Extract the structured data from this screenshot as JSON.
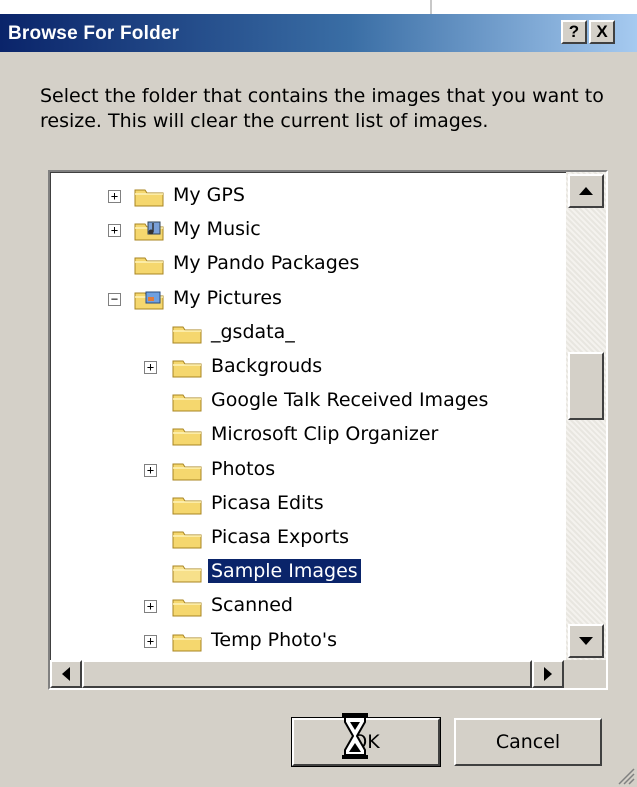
{
  "dialog": {
    "title": "Browse For Folder",
    "help_button": "?",
    "close_button": "X",
    "prompt": "Select the folder that contains the images that you want to resize.  This will clear the current list of images."
  },
  "tree": {
    "items": [
      {
        "label": "My GPS",
        "expander": "+",
        "icon": "folder-icon"
      },
      {
        "label": "My Music",
        "expander": "+",
        "icon": "music-folder-icon"
      },
      {
        "label": "My Pando Packages",
        "expander": "",
        "icon": "folder-icon"
      },
      {
        "label": "My Pictures",
        "expander": "−",
        "icon": "pictures-folder-icon"
      },
      {
        "label": "_gsdata_",
        "expander": "",
        "icon": "folder-icon"
      },
      {
        "label": "Backgrouds",
        "expander": "+",
        "icon": "folder-icon"
      },
      {
        "label": "Google Talk Received Images",
        "expander": "",
        "icon": "folder-icon"
      },
      {
        "label": "Microsoft Clip Organizer",
        "expander": "",
        "icon": "folder-icon"
      },
      {
        "label": "Photos",
        "expander": "+",
        "icon": "folder-icon"
      },
      {
        "label": "Picasa Edits",
        "expander": "",
        "icon": "folder-icon"
      },
      {
        "label": "Picasa Exports",
        "expander": "",
        "icon": "folder-icon"
      },
      {
        "label": "Sample Images",
        "expander": "",
        "icon": "open-folder-icon",
        "selected": true
      },
      {
        "label": "Scanned",
        "expander": "+",
        "icon": "folder-icon"
      },
      {
        "label": "Temp Photo's",
        "expander": "+",
        "icon": "folder-icon"
      }
    ]
  },
  "buttons": {
    "ok": "OK",
    "cancel": "Cancel"
  },
  "colors": {
    "title_start": "#0a246a",
    "title_end": "#a6caf0",
    "selection": "#0a246a",
    "face": "#d4d0c8",
    "folder": "#f5d76e"
  }
}
